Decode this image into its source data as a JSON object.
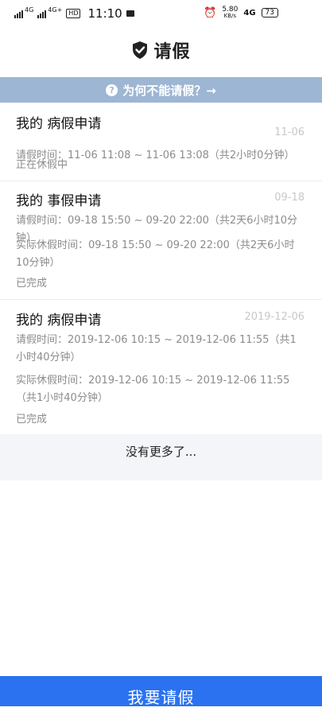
{
  "status": {
    "net1": "4G",
    "net2": "4G+",
    "hd": "HD",
    "time": "11:10",
    "speed_value": "5.80",
    "speed_unit": "KB/s",
    "net3": "4G",
    "battery": "73"
  },
  "header": {
    "title": "请假"
  },
  "banner": {
    "text": "为何不能请假？→"
  },
  "records": [
    {
      "title": "我的 病假申请",
      "date": "11-06",
      "lines": [
        "请假时间：11-06 11:08 ~ 11-06 13:08（共2小时0分钟）"
      ],
      "status": "正在休假中"
    },
    {
      "title": "我的 事假申请",
      "date": "09-18",
      "lines": [
        "请假时间：09-18 15:50 ~ 09-20 22:00（共2天6小时10分钟）",
        "实际休假时间：09-18 15:50 ~ 09-20 22:00（共2天6小时10分钟）"
      ],
      "status": "已完成"
    },
    {
      "title": "我的 病假申请",
      "date": "2019-12-06",
      "lines": [
        "请假时间：2019-12-06 10:15 ~ 2019-12-06 11:55（共1小时40分钟）",
        "实际休假时间：2019-12-06 10:15 ~ 2019-12-06 11:55（共1小时40分钟）"
      ],
      "status": "已完成"
    }
  ],
  "footer_note": "没有更多了...",
  "apply_button": "我要请假"
}
